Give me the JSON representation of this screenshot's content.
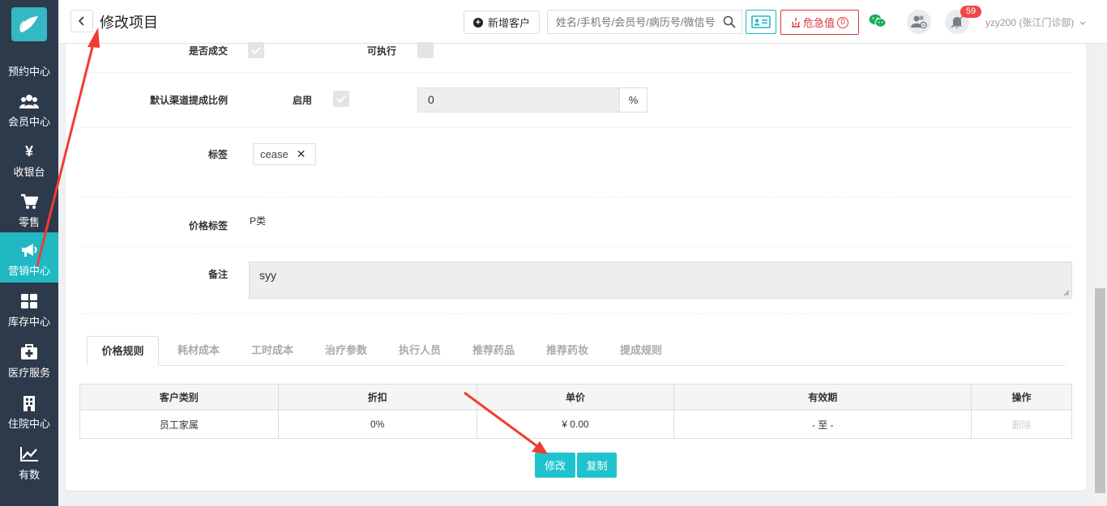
{
  "sidebar": {
    "items": [
      {
        "label": "预约中心",
        "icon": "calendar-icon"
      },
      {
        "label": "会员中心",
        "icon": "users-icon"
      },
      {
        "label": "收银台",
        "icon": "yen-icon"
      },
      {
        "label": "零售",
        "icon": "cart-icon"
      },
      {
        "label": "营销中心",
        "icon": "megaphone-icon",
        "active": true
      },
      {
        "label": "库存中心",
        "icon": "grid-icon"
      },
      {
        "label": "医疗服务",
        "icon": "medical-kit-icon"
      },
      {
        "label": "住院中心",
        "icon": "building-icon"
      },
      {
        "label": "有数",
        "icon": "chart-line-icon"
      }
    ]
  },
  "header": {
    "title": "修改项目",
    "new_customer": "新增客户",
    "search_placeholder": "姓名/手机号/会员号/病历号/微信号",
    "critical_label": "危急值",
    "critical_count": "0",
    "notification_count": "59",
    "user": "yzy200 (张江门诊部)"
  },
  "form": {
    "deal_label": "是否成交",
    "executable_label": "可执行",
    "commission_label": "默认渠道提成比例",
    "enable_label": "启用",
    "commission_value": "0",
    "percent_unit": "%",
    "tags_label": "标签",
    "tag_value": "cease",
    "price_tag_label": "价格标签",
    "price_tag_value": "P类",
    "remark_label": "备注",
    "remark_value": "syy"
  },
  "tabs": [
    "价格规则",
    "耗材成本",
    "工时成本",
    "治疗参数",
    "执行人员",
    "推荐药品",
    "推荐药妆",
    "提成规则"
  ],
  "table": {
    "headers": [
      "客户类别",
      "折扣",
      "单价",
      "有效期",
      "操作"
    ],
    "rows": [
      [
        "员工家属",
        "0%",
        "¥ 0.00",
        "- 至 -",
        "删除"
      ]
    ]
  },
  "actions": {
    "edit": "修改",
    "copy": "复制"
  },
  "colors": {
    "sidebar_bg": "#2d3a4b",
    "accent": "#1fb8c3",
    "danger": "#d9363e",
    "annotation": "#f03c30"
  }
}
